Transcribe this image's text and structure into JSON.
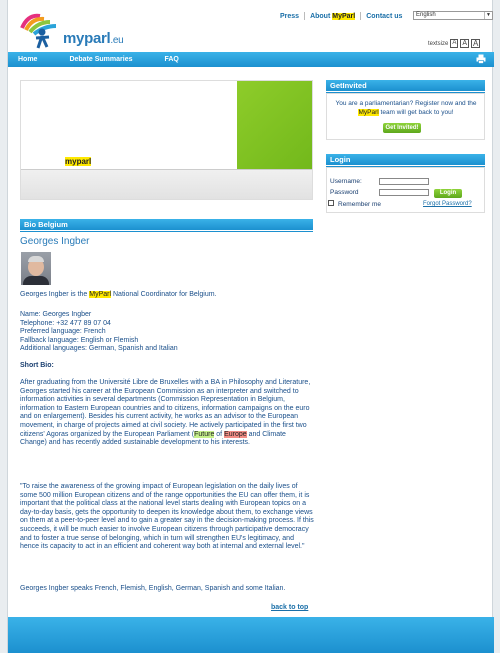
{
  "header": {
    "logo_text": "myparl",
    "logo_tld": ".eu",
    "links": [
      "Press",
      "About",
      "MyParl",
      "Contact us"
    ],
    "language": "English",
    "textsize_label": "textsize",
    "textsize_options": [
      "A",
      "A",
      "A"
    ]
  },
  "nav": {
    "items": [
      "Home",
      "Debate Summaries",
      "FAQ"
    ],
    "print_icon": "printer-icon"
  },
  "banner": {
    "brand": "myparl"
  },
  "bio": {
    "section_title": "Bio Belgium",
    "name": "Georges Ingber",
    "intro_pre": "Georges Ingber is the ",
    "intro_hl": "MyParl",
    "intro_post": " National Coordinator for Belgium.",
    "contact": [
      "Name: Georges Ingber",
      "Telephone: +32 477 89 07 04",
      "Preferred language: French",
      "Fallback language: English or Flemish",
      "Additional languages: German, Spanish and Italian"
    ],
    "short_bio_heading": "Short Bio:",
    "paragraph1_pre": "After graduating from the Université Libre de Bruxelles with a BA in Philosophy and Literature, Georges started his career at the European Commission as an interpreter and switched to information activities in several departments (Commission Representation in Belgium, information to Eastern European countries and to citizens, information campaigns on the euro and on enlargement). Besides his current activity, he works as an advisor to the European movement, in charge of projects aimed at civil society. He actively participated in the first two citizens' Agoras organized by the European Parliament (",
    "paragraph1_hl1": "Future",
    "paragraph1_mid": " of ",
    "paragraph1_hl2": "Europe",
    "paragraph1_post": " and Climate Change) and has recently added sustainable development to his interests.",
    "quote": "\"To raise the awareness of the growing impact of European legislation on the daily lives of some 500 million European citizens and of the range opportunities the EU can offer them, it is important that the political class at the national level starts dealing with European topics on a day-to-day basis, gets the opportunity to deepen its knowledge about them, to exchange views on them at a peer-to-peer level and to gain a greater say in the decision-making process. If this succeeds, it will be much easier to involve European citizens through participative democracy and to foster a true sense of belonging, which in turn will strengthen EU's legitimacy, and hence its capacity to act in an efficient and coherent way both at internal and external level.\"",
    "languages_line": "Georges Ingber speaks French, Flemish, English, German, Spanish and some Italian.",
    "back_to_top": "back to top"
  },
  "get_invited": {
    "title": "GetInvited",
    "text_pre": "You are a parliamentarian? Register now and the ",
    "text_hl": "MyParl",
    "text_post": " team will get back to you!",
    "button": "Get Invited!"
  },
  "login": {
    "title": "Login",
    "username_label": "Username:",
    "password_label": "Password",
    "button": "Login",
    "remember_label": "Remember me",
    "forgot_link": "Forgot Password?"
  }
}
